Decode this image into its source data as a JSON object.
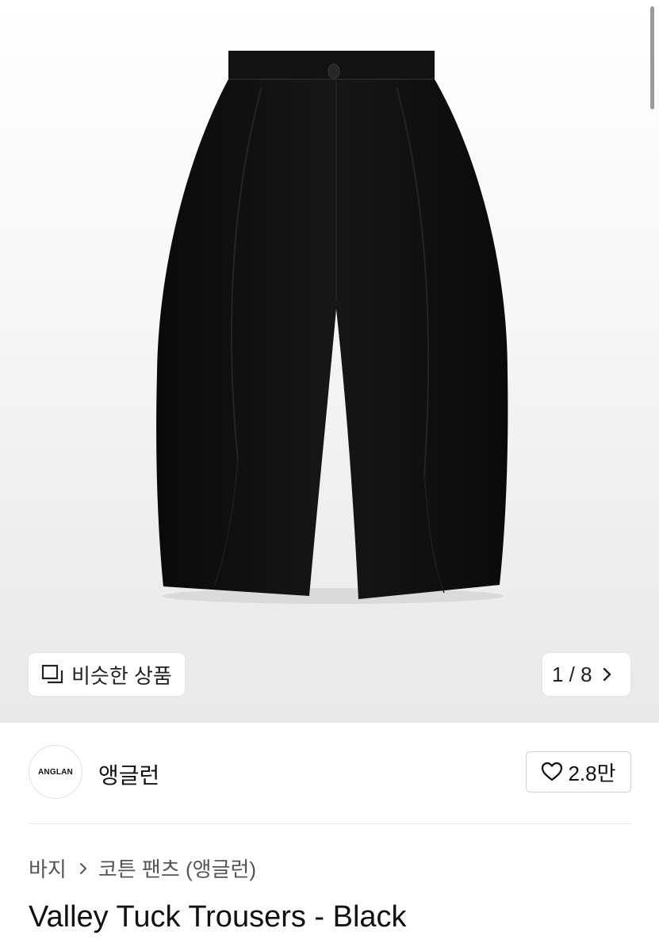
{
  "gallery": {
    "image_alt": "Black wide tuck trousers",
    "similar_label": "비슷한 상품",
    "counter": "1 / 8"
  },
  "seller": {
    "logo_text": "ANGLAN",
    "name": "앵글런",
    "likes": "2.8만"
  },
  "breadcrumb": {
    "category": "바지",
    "subcategory": "코튼 팬츠 (앵글런)"
  },
  "product": {
    "title": "Valley Tuck Trousers - Black"
  },
  "colors": {
    "garment": "#0d0d0d",
    "chip_bg": "#ffffff",
    "divider": "#e6e6e6"
  }
}
